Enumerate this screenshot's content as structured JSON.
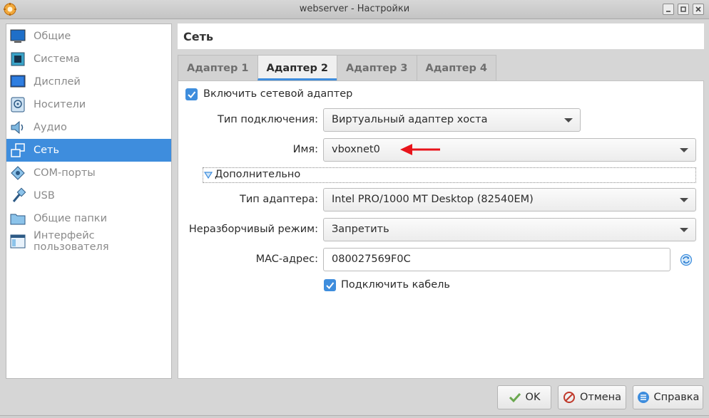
{
  "window": {
    "title": "webserver - Настройки"
  },
  "sidebar": {
    "items": [
      {
        "label": "Общие",
        "icon": "general-icon"
      },
      {
        "label": "Система",
        "icon": "system-icon"
      },
      {
        "label": "Дисплей",
        "icon": "display-icon"
      },
      {
        "label": "Носители",
        "icon": "storage-icon"
      },
      {
        "label": "Аудио",
        "icon": "audio-icon"
      },
      {
        "label": "Сеть",
        "icon": "network-icon",
        "active": true
      },
      {
        "label": "COM-порты",
        "icon": "serial-ports-icon"
      },
      {
        "label": "USB",
        "icon": "usb-icon"
      },
      {
        "label": "Общие папки",
        "icon": "shared-folders-icon"
      },
      {
        "label": "Интерфейс пользователя",
        "icon": "user-interface-icon"
      }
    ]
  },
  "section": {
    "title": "Сеть"
  },
  "tabs": [
    {
      "label": "Адаптер 1"
    },
    {
      "label": "Адаптер 2",
      "active": true
    },
    {
      "label": "Адаптер 3"
    },
    {
      "label": "Адаптер 4"
    }
  ],
  "adapter": {
    "enable_label": "Включить сетевой адаптер",
    "enable_checked": true,
    "attachment_label": "Тип подключения:",
    "attachment_value": "Виртуальный адаптер хоста",
    "name_label": "Имя:",
    "name_value": "vboxnet0",
    "advanced_label": "Дополнительно",
    "adapter_type_label": "Тип адаптера:",
    "adapter_type_value": "Intel PRO/1000 MT Desktop (82540EM)",
    "promiscuous_label": "Неразборчивый режим:",
    "promiscuous_value": "Запретить",
    "mac_label": "MAC-адрес:",
    "mac_value": "080027569F0C",
    "cable_label": "Подключить кабель",
    "cable_checked": true
  },
  "buttons": {
    "ok": "OK",
    "cancel": "Отмена",
    "help": "Справка"
  },
  "colors": {
    "accent": "#3e8ddd",
    "annotation_arrow": "#e8141b"
  }
}
